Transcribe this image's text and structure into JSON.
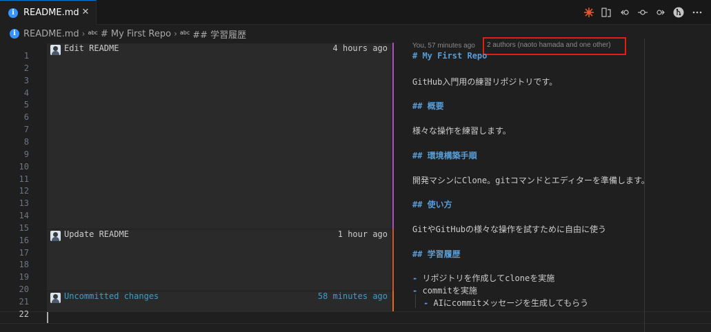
{
  "tab": {
    "label": "README.md",
    "close": "✕"
  },
  "toolbar": {
    "icons": [
      "copilot-icon",
      "open-changes-icon",
      "go-back-icon",
      "commit-icon",
      "go-forward-icon",
      "gitlens-icon"
    ]
  },
  "breadcrumb": {
    "file": "README.md",
    "symbol_icon": "abc",
    "symbol1": "# My First Repo",
    "symbol2": "## 学習履歴"
  },
  "editor": {
    "line_numbers": [
      "1",
      "2",
      "3",
      "4",
      "5",
      "6",
      "7",
      "8",
      "9",
      "10",
      "11",
      "12",
      "13",
      "14",
      "15",
      "16",
      "17",
      "18",
      "19",
      "20",
      "21",
      "22"
    ],
    "active_line": "22",
    "inline_blame": "You, 57 minutes ago",
    "authors_hover": "2 authors (naoto hamada and one other)",
    "blame": [
      {
        "message": "Edit README",
        "time": "4 hours ago",
        "color": "#b04fc9"
      },
      {
        "message": "Update README",
        "time": "1 hour ago",
        "color": "#d2552c"
      },
      {
        "message": "Uncommitted changes",
        "time": "58 minutes ago",
        "color": "#ef6a18"
      }
    ],
    "code": [
      {
        "text": "# My First Repo",
        "kind": "heading"
      },
      {
        "text": "",
        "kind": "plain"
      },
      {
        "text": "GitHub入門用の練習リポジトリです。",
        "kind": "plain"
      },
      {
        "text": "",
        "kind": "plain"
      },
      {
        "text": "## 概要",
        "kind": "heading"
      },
      {
        "text": "",
        "kind": "plain"
      },
      {
        "text": "様々な操作を練習します。",
        "kind": "plain"
      },
      {
        "text": "",
        "kind": "plain"
      },
      {
        "text": "## 環境構築手順",
        "kind": "heading"
      },
      {
        "text": "",
        "kind": "plain"
      },
      {
        "text": "開発マシンにClone。gitコマンドとエディターを準備します。",
        "kind": "plain"
      },
      {
        "text": "",
        "kind": "plain"
      },
      {
        "text": "## 使い方",
        "kind": "heading"
      },
      {
        "text": "",
        "kind": "plain"
      },
      {
        "text": "GitやGitHubの様々な操作を試すために自由に使う",
        "kind": "plain"
      },
      {
        "text": "",
        "kind": "plain"
      },
      {
        "text": "## 学習履歴",
        "kind": "heading"
      },
      {
        "text": "",
        "kind": "plain"
      },
      {
        "bullet": "-",
        "text": "リポジトリを作成してcloneを実施",
        "kind": "list"
      },
      {
        "bullet": "-",
        "text": "commitを実施",
        "kind": "list"
      },
      {
        "bullet": "-",
        "text": "AIにcommitメッセージを生成してもらう",
        "kind": "sublist"
      },
      {
        "text": "",
        "kind": "plain"
      }
    ]
  },
  "colors": {
    "accent": "#0078d4",
    "heading": "#569cd6",
    "highlight_box": "#e51d12"
  }
}
